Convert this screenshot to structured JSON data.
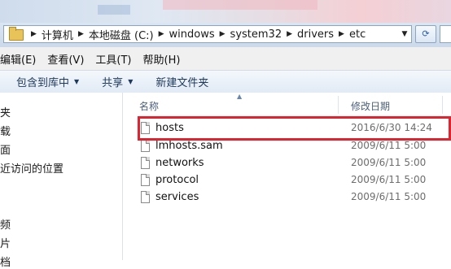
{
  "address": {
    "crumbs": [
      "计算机",
      "本地磁盘 (C:)",
      "windows",
      "system32",
      "drivers",
      "etc"
    ]
  },
  "menu": [
    "编辑(E)",
    "查看(V)",
    "工具(T)",
    "帮助(H)"
  ],
  "toolbar": {
    "include_library": "包含到库中",
    "share": "共享",
    "new_folder": "新建文件夹"
  },
  "nav": [
    "夹",
    "载",
    "面",
    "近访问的位置",
    "频",
    "片",
    "档"
  ],
  "columns": {
    "name": "名称",
    "date_modified": "修改日期",
    "more": ""
  },
  "files": [
    {
      "name": "hosts",
      "date": "2016/6/30 14:24",
      "more": ""
    },
    {
      "name": "lmhosts.sam",
      "date": "2009/6/11 5:00",
      "more": ""
    },
    {
      "name": "networks",
      "date": "2009/6/11 5:00",
      "more": ""
    },
    {
      "name": "protocol",
      "date": "2009/6/11 5:00",
      "more": ""
    },
    {
      "name": "services",
      "date": "2009/6/11 5:00",
      "more": ""
    }
  ],
  "colors": {
    "highlight": "#e0232f",
    "header_text": "#4c607a",
    "toolbar_text": "#1e395b"
  },
  "icons": [
    "folder-icon",
    "chevron-right-icon",
    "chevron-down-icon",
    "refresh-icon",
    "sort-up-icon",
    "file-icon"
  ]
}
